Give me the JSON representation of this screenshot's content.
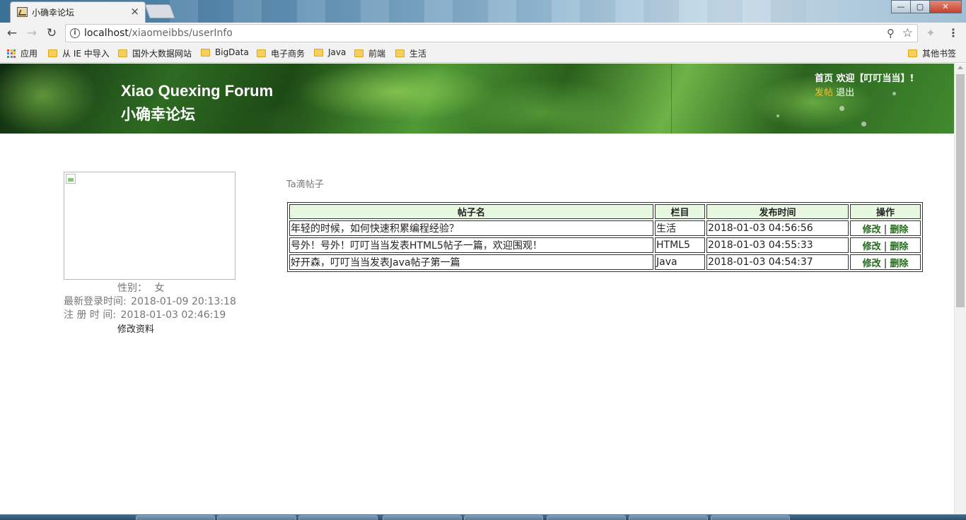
{
  "browser": {
    "tab_title": "小确幸论坛",
    "tab_close": "×",
    "window_buttons": [
      "—",
      "▢",
      "✕"
    ],
    "url_host": "localhost",
    "url_path": "/xiaomeibbs/userInfo",
    "bookmarks": [
      {
        "label": "应用",
        "type": "apps"
      },
      {
        "label": "从 IE 中导入",
        "type": "folder"
      },
      {
        "label": "国外大数据网站",
        "type": "folder"
      },
      {
        "label": "BigData",
        "type": "folder"
      },
      {
        "label": "电子商务",
        "type": "folder"
      },
      {
        "label": "Java",
        "type": "folder"
      },
      {
        "label": "前端",
        "type": "folder"
      },
      {
        "label": "生活",
        "type": "folder"
      },
      {
        "label": "其他书签",
        "type": "folder"
      }
    ]
  },
  "header": {
    "title_en": "Xiao Quexing Forum",
    "title_cn": "小确幸论坛",
    "home": "首页",
    "welcome": "欢迎【叮叮当当】!",
    "post": "发帖",
    "logout": "退出"
  },
  "profile": {
    "gender_label": "性别：",
    "gender": "女",
    "last_login_label": "最新登录时间:",
    "last_login": "2018-01-09 20:13:18",
    "register_label": "注 册 时 间:",
    "register": "2018-01-03 02:46:19",
    "edit": "修改资料"
  },
  "posts": {
    "title": "Ta滴帖子",
    "headers": [
      "帖子名",
      "栏目",
      "发布时间",
      "操作"
    ],
    "edit_label": "修改",
    "delete_label": "删除",
    "separator": "|",
    "rows": [
      {
        "name": "年轻的时候，如何快速积累编程经验？",
        "column": "生活",
        "time": "2018-01-03 04:56:56"
      },
      {
        "name": "号外！号外！叮叮当当发表HTML5帖子一篇，欢迎围观！",
        "column": "HTML5",
        "time": "2018-01-03 04:55:33"
      },
      {
        "name": "好开森，叮叮当当发表Java帖子第一篇",
        "column": "Java",
        "time": "2018-01-03 04:54:37"
      }
    ]
  },
  "colors": {
    "action_green": "#226b1c",
    "post_link": "#f2c22c",
    "table_header_bg": "#e8f7e2"
  }
}
